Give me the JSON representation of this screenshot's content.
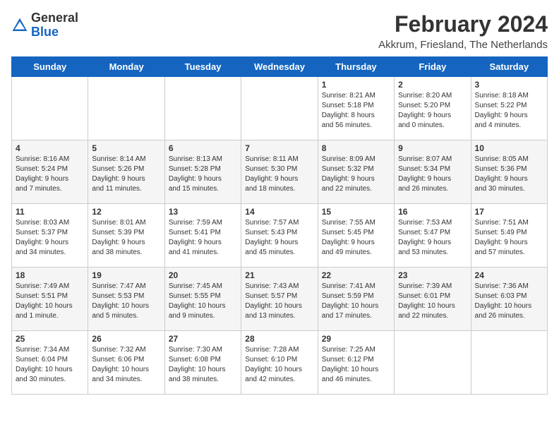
{
  "header": {
    "logo_line1": "General",
    "logo_line2": "Blue",
    "month_title": "February 2024",
    "location": "Akkrum, Friesland, The Netherlands"
  },
  "weekdays": [
    "Sunday",
    "Monday",
    "Tuesday",
    "Wednesday",
    "Thursday",
    "Friday",
    "Saturday"
  ],
  "weeks": [
    [
      {
        "day": "",
        "info": ""
      },
      {
        "day": "",
        "info": ""
      },
      {
        "day": "",
        "info": ""
      },
      {
        "day": "",
        "info": ""
      },
      {
        "day": "1",
        "info": "Sunrise: 8:21 AM\nSunset: 5:18 PM\nDaylight: 8 hours\nand 56 minutes."
      },
      {
        "day": "2",
        "info": "Sunrise: 8:20 AM\nSunset: 5:20 PM\nDaylight: 9 hours\nand 0 minutes."
      },
      {
        "day": "3",
        "info": "Sunrise: 8:18 AM\nSunset: 5:22 PM\nDaylight: 9 hours\nand 4 minutes."
      }
    ],
    [
      {
        "day": "4",
        "info": "Sunrise: 8:16 AM\nSunset: 5:24 PM\nDaylight: 9 hours\nand 7 minutes."
      },
      {
        "day": "5",
        "info": "Sunrise: 8:14 AM\nSunset: 5:26 PM\nDaylight: 9 hours\nand 11 minutes."
      },
      {
        "day": "6",
        "info": "Sunrise: 8:13 AM\nSunset: 5:28 PM\nDaylight: 9 hours\nand 15 minutes."
      },
      {
        "day": "7",
        "info": "Sunrise: 8:11 AM\nSunset: 5:30 PM\nDaylight: 9 hours\nand 18 minutes."
      },
      {
        "day": "8",
        "info": "Sunrise: 8:09 AM\nSunset: 5:32 PM\nDaylight: 9 hours\nand 22 minutes."
      },
      {
        "day": "9",
        "info": "Sunrise: 8:07 AM\nSunset: 5:34 PM\nDaylight: 9 hours\nand 26 minutes."
      },
      {
        "day": "10",
        "info": "Sunrise: 8:05 AM\nSunset: 5:36 PM\nDaylight: 9 hours\nand 30 minutes."
      }
    ],
    [
      {
        "day": "11",
        "info": "Sunrise: 8:03 AM\nSunset: 5:37 PM\nDaylight: 9 hours\nand 34 minutes."
      },
      {
        "day": "12",
        "info": "Sunrise: 8:01 AM\nSunset: 5:39 PM\nDaylight: 9 hours\nand 38 minutes."
      },
      {
        "day": "13",
        "info": "Sunrise: 7:59 AM\nSunset: 5:41 PM\nDaylight: 9 hours\nand 41 minutes."
      },
      {
        "day": "14",
        "info": "Sunrise: 7:57 AM\nSunset: 5:43 PM\nDaylight: 9 hours\nand 45 minutes."
      },
      {
        "day": "15",
        "info": "Sunrise: 7:55 AM\nSunset: 5:45 PM\nDaylight: 9 hours\nand 49 minutes."
      },
      {
        "day": "16",
        "info": "Sunrise: 7:53 AM\nSunset: 5:47 PM\nDaylight: 9 hours\nand 53 minutes."
      },
      {
        "day": "17",
        "info": "Sunrise: 7:51 AM\nSunset: 5:49 PM\nDaylight: 9 hours\nand 57 minutes."
      }
    ],
    [
      {
        "day": "18",
        "info": "Sunrise: 7:49 AM\nSunset: 5:51 PM\nDaylight: 10 hours\nand 1 minute."
      },
      {
        "day": "19",
        "info": "Sunrise: 7:47 AM\nSunset: 5:53 PM\nDaylight: 10 hours\nand 5 minutes."
      },
      {
        "day": "20",
        "info": "Sunrise: 7:45 AM\nSunset: 5:55 PM\nDaylight: 10 hours\nand 9 minutes."
      },
      {
        "day": "21",
        "info": "Sunrise: 7:43 AM\nSunset: 5:57 PM\nDaylight: 10 hours\nand 13 minutes."
      },
      {
        "day": "22",
        "info": "Sunrise: 7:41 AM\nSunset: 5:59 PM\nDaylight: 10 hours\nand 17 minutes."
      },
      {
        "day": "23",
        "info": "Sunrise: 7:39 AM\nSunset: 6:01 PM\nDaylight: 10 hours\nand 22 minutes."
      },
      {
        "day": "24",
        "info": "Sunrise: 7:36 AM\nSunset: 6:03 PM\nDaylight: 10 hours\nand 26 minutes."
      }
    ],
    [
      {
        "day": "25",
        "info": "Sunrise: 7:34 AM\nSunset: 6:04 PM\nDaylight: 10 hours\nand 30 minutes."
      },
      {
        "day": "26",
        "info": "Sunrise: 7:32 AM\nSunset: 6:06 PM\nDaylight: 10 hours\nand 34 minutes."
      },
      {
        "day": "27",
        "info": "Sunrise: 7:30 AM\nSunset: 6:08 PM\nDaylight: 10 hours\nand 38 minutes."
      },
      {
        "day": "28",
        "info": "Sunrise: 7:28 AM\nSunset: 6:10 PM\nDaylight: 10 hours\nand 42 minutes."
      },
      {
        "day": "29",
        "info": "Sunrise: 7:25 AM\nSunset: 6:12 PM\nDaylight: 10 hours\nand 46 minutes."
      },
      {
        "day": "",
        "info": ""
      },
      {
        "day": "",
        "info": ""
      }
    ]
  ]
}
